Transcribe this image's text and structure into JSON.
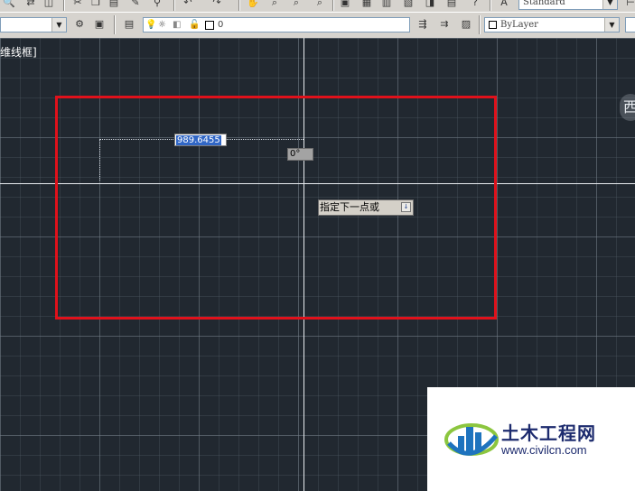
{
  "toolbar_top": {
    "text_style_combo": "Standard"
  },
  "toolbar_layers": {
    "layer_name": "0",
    "color_combo": "ByLayer"
  },
  "viewport": {
    "label": "维线框]"
  },
  "dynamic_input": {
    "length_value": "989.6455",
    "angle_value": "0°",
    "prompt_text": "指定下一点或",
    "prompt_arrow": "↓"
  },
  "viewcube": {
    "west_label": "西"
  },
  "watermark": {
    "site_name": "土木工程网",
    "url": "www.civilcn.com"
  },
  "colors": {
    "canvas_bg": "#212830",
    "highlight_frame": "#e0111b",
    "selection_text_bg": "#3167c6"
  }
}
